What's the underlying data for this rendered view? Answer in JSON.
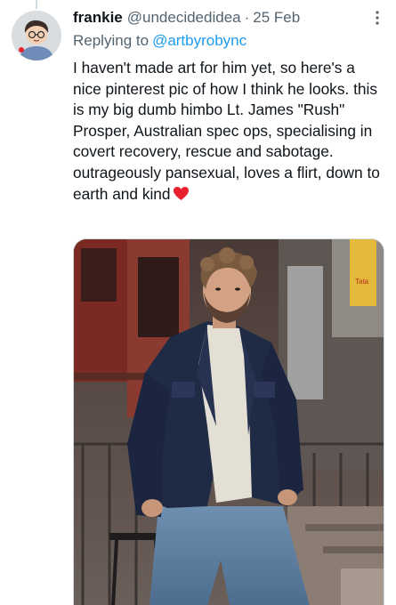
{
  "tweet": {
    "display_name": "frankie",
    "handle": "@undecidedidea",
    "separator": "·",
    "date": "25 Feb",
    "replying_prefix": "Replying to",
    "replying_to": "@artbyrobync",
    "text": "I haven't made art for him yet, so here's a nice pinterest pic of how I think he looks. this is my big dumb himbo Lt. James \"Rush\" Prosper, Australian spec ops, specialising in covert recovery, rescue and sabotage.\noutrageously pansexual, loves a flirt, down to earth and kind",
    "emoji": "red-heart",
    "more_icon": "more-vertical-icon",
    "colors": {
      "text": "#0f1419",
      "secondary": "#536471",
      "link": "#1d9bf0",
      "heart": "#e8202f"
    }
  },
  "media": {
    "sign_text": "Tata"
  }
}
